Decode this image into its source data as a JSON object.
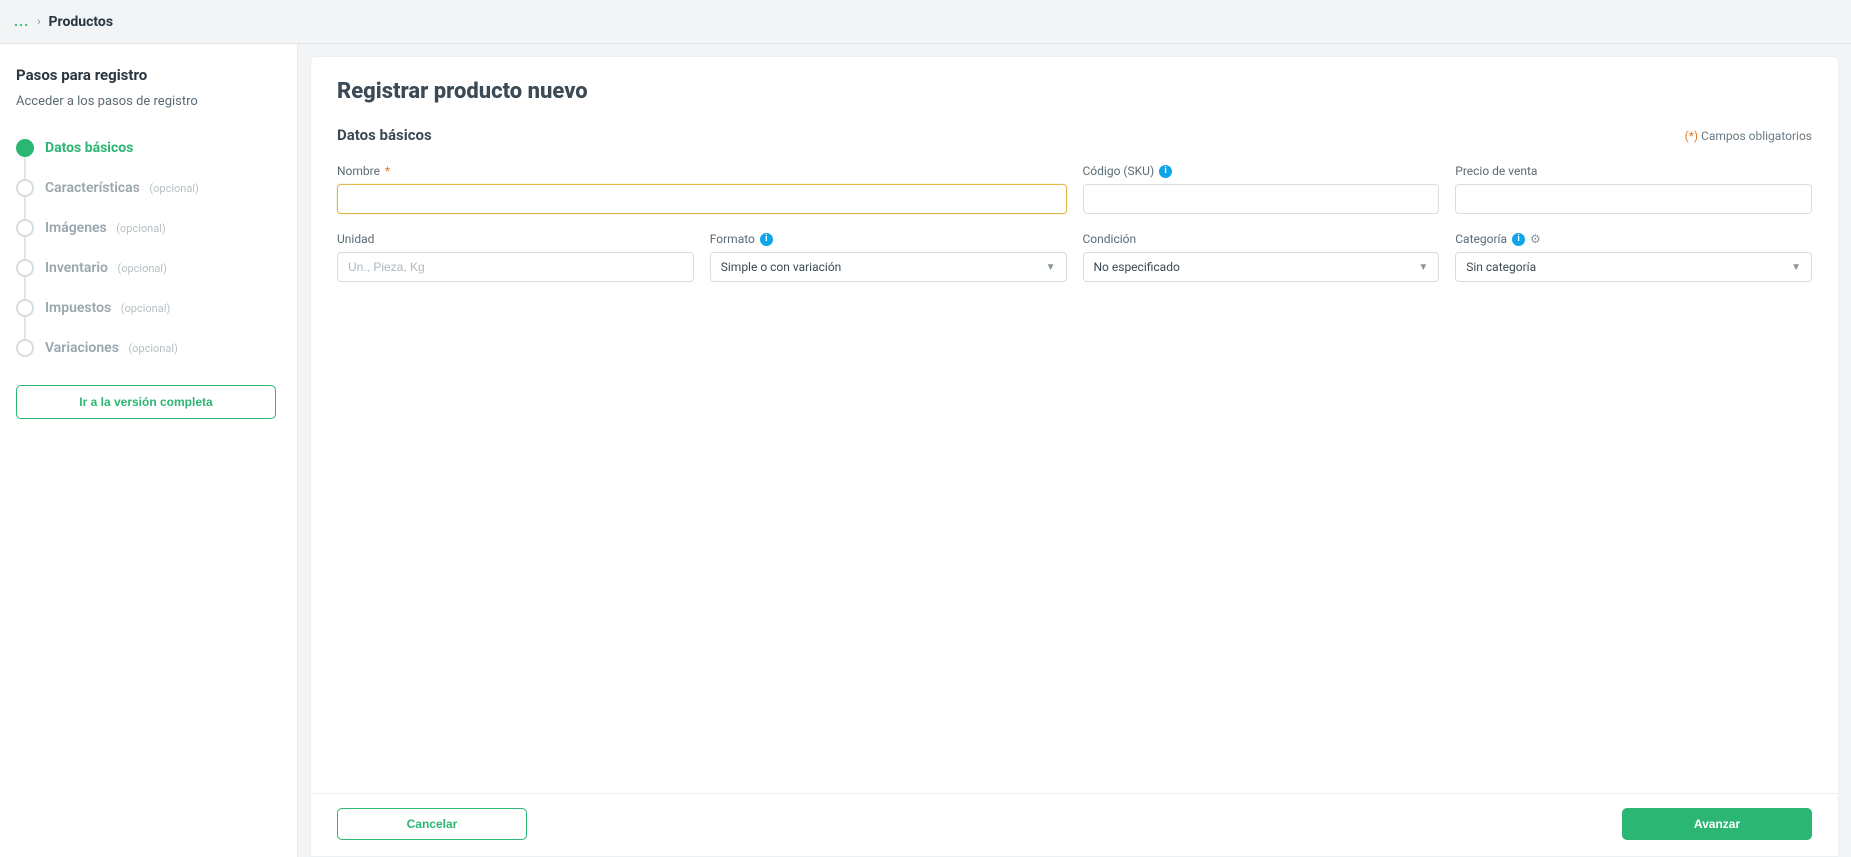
{
  "breadcrumb": {
    "ellipsis": "...",
    "current": "Productos"
  },
  "sidebar": {
    "title": "Pasos para registro",
    "subtitle": "Acceder a los pasos de registro",
    "steps": [
      {
        "label": "Datos básicos",
        "optional": "",
        "active": true
      },
      {
        "label": "Características",
        "optional": "(opcional)",
        "active": false
      },
      {
        "label": "Imágenes",
        "optional": "(opcional)",
        "active": false
      },
      {
        "label": "Inventario",
        "optional": "(opcional)",
        "active": false
      },
      {
        "label": "Impuestos",
        "optional": "(opcional)",
        "active": false
      },
      {
        "label": "Variaciones",
        "optional": "(opcional)",
        "active": false
      }
    ],
    "full_version_btn": "Ir a la versión completa"
  },
  "page": {
    "title": "Registrar producto nuevo",
    "section_title": "Datos básicos",
    "required_note_prefix": "(*)",
    "required_note_text": " Campos obligatorios"
  },
  "fields": {
    "nombre": {
      "label": "Nombre",
      "required": "*",
      "value": ""
    },
    "sku": {
      "label": "Código (SKU)",
      "value": ""
    },
    "precio": {
      "label": "Precio de venta",
      "value": ""
    },
    "unidad": {
      "label": "Unidad",
      "placeholder": "Un., Pieza, Kg",
      "value": ""
    },
    "formato": {
      "label": "Formato",
      "value": "Simple o con variación"
    },
    "condicion": {
      "label": "Condición",
      "value": "No especificado"
    },
    "categoria": {
      "label": "Categoría",
      "value": "Sin categoría"
    }
  },
  "footer": {
    "cancel": "Cancelar",
    "next": "Avanzar"
  }
}
